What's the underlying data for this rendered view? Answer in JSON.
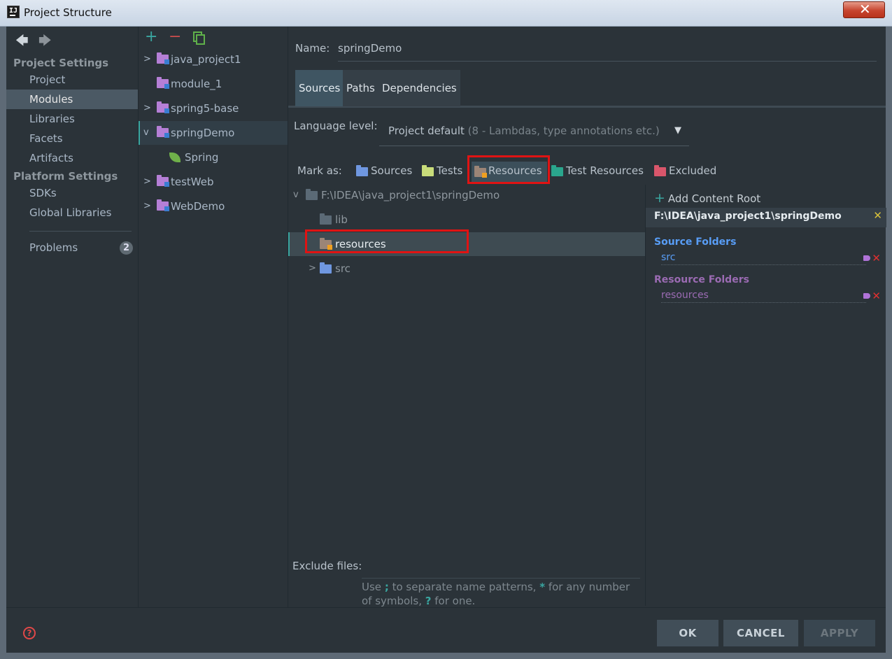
{
  "window": {
    "title": "Project Structure",
    "app_icon_text": "IJ"
  },
  "sidebar": {
    "project_settings_header": "Project Settings",
    "platform_settings_header": "Platform Settings",
    "items": [
      {
        "label": "Project"
      },
      {
        "label": "Modules"
      },
      {
        "label": "Libraries"
      },
      {
        "label": "Facets"
      },
      {
        "label": "Artifacts"
      },
      {
        "label": "SDKs"
      },
      {
        "label": "Global Libraries"
      }
    ],
    "problems": {
      "label": "Problems",
      "count": "2"
    }
  },
  "modules": [
    {
      "label": "java_project1",
      "expandable": true
    },
    {
      "label": "module_1",
      "expandable": false
    },
    {
      "label": "spring5-base",
      "expandable": true
    },
    {
      "label": "springDemo",
      "expandable": true,
      "expanded": true,
      "selected": true
    },
    {
      "label": "Spring",
      "child": true,
      "icon": "spring-leaf-icon"
    },
    {
      "label": "testWeb",
      "expandable": true
    },
    {
      "label": "WebDemo",
      "expandable": true
    }
  ],
  "module_settings": {
    "name_label": "Name:",
    "name_value": "springDemo",
    "tabs": [
      {
        "label": "Sources"
      },
      {
        "label": "Paths"
      },
      {
        "label": "Dependencies"
      }
    ],
    "language_level_label": "Language level:",
    "language_level_value": "Project default",
    "language_level_hint": "(8 - Lambdas, type annotations etc.)",
    "mark_as_label": "Mark as:",
    "mark_as": [
      {
        "label": "Sources",
        "color": "#6f97e0"
      },
      {
        "label": "Tests",
        "color": "#c8dc7a"
      },
      {
        "label": "Resources",
        "color": "#9b8577",
        "selected": true
      },
      {
        "label": "Test Resources",
        "color": "#2aa68d"
      },
      {
        "label": "Excluded",
        "color": "#d9566b"
      }
    ],
    "content_tree": {
      "root": "F:\\IDEA\\java_project1\\springDemo",
      "children": [
        {
          "label": "lib"
        },
        {
          "label": "resources",
          "selected": true
        },
        {
          "label": "src",
          "expandable": true
        }
      ]
    },
    "content_root_panel": {
      "add_label": "Add Content Root",
      "root_path": "F:\\IDEA\\java_project1\\springDemo",
      "source_folders_title": "Source Folders",
      "source_folders": [
        "src"
      ],
      "resource_folders_title": "Resource Folders",
      "resource_folders": [
        "resources"
      ]
    },
    "exclude_files_label": "Exclude files:",
    "exclude_hint_1": "Use",
    "exclude_hint_semicolon": ";",
    "exclude_hint_2": "to separate name patterns,",
    "exclude_hint_star": "*",
    "exclude_hint_3": "for any number of symbols,",
    "exclude_hint_q": "?",
    "exclude_hint_4": "for one."
  },
  "footer": {
    "ok": "OK",
    "cancel": "CANCEL",
    "apply": "APPLY"
  },
  "colors": {
    "accent_teal": "#3aa6a0",
    "module_folder": "#b57fd6",
    "source_folders_title": "#589df6",
    "resource_folders_title": "#9b6bb3",
    "highlight_box": "#e01313"
  }
}
